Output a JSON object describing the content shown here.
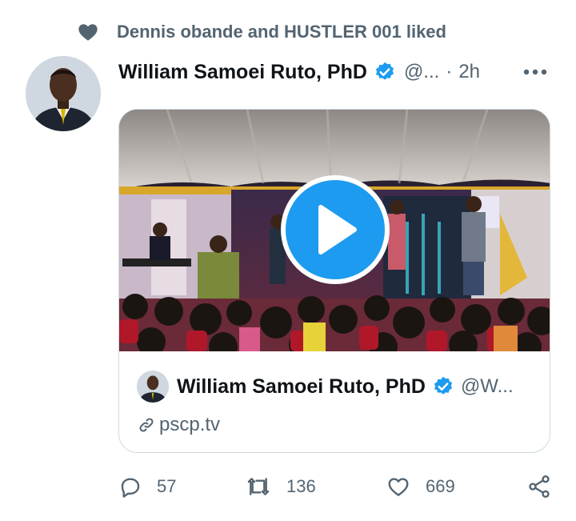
{
  "social_context": {
    "text": "Dennis obande and HUSTLER 001 liked",
    "icon": "heart-icon"
  },
  "tweet": {
    "author_name": "William Samoei Ruto, PhD",
    "handle": "@...",
    "separator": "·",
    "time": "2h",
    "more_icon": "more-horizontal-icon"
  },
  "card": {
    "media_icon": "play-icon",
    "embed_name": "William Samoei Ruto, PhD",
    "embed_handle": "@W...",
    "link": "pscp.tv"
  },
  "actions": {
    "reply_count": "57",
    "retweet_count": "136",
    "like_count": "669"
  },
  "colors": {
    "accent": "#1d9bf0",
    "text_secondary": "#536471",
    "border": "#cfd9de"
  }
}
